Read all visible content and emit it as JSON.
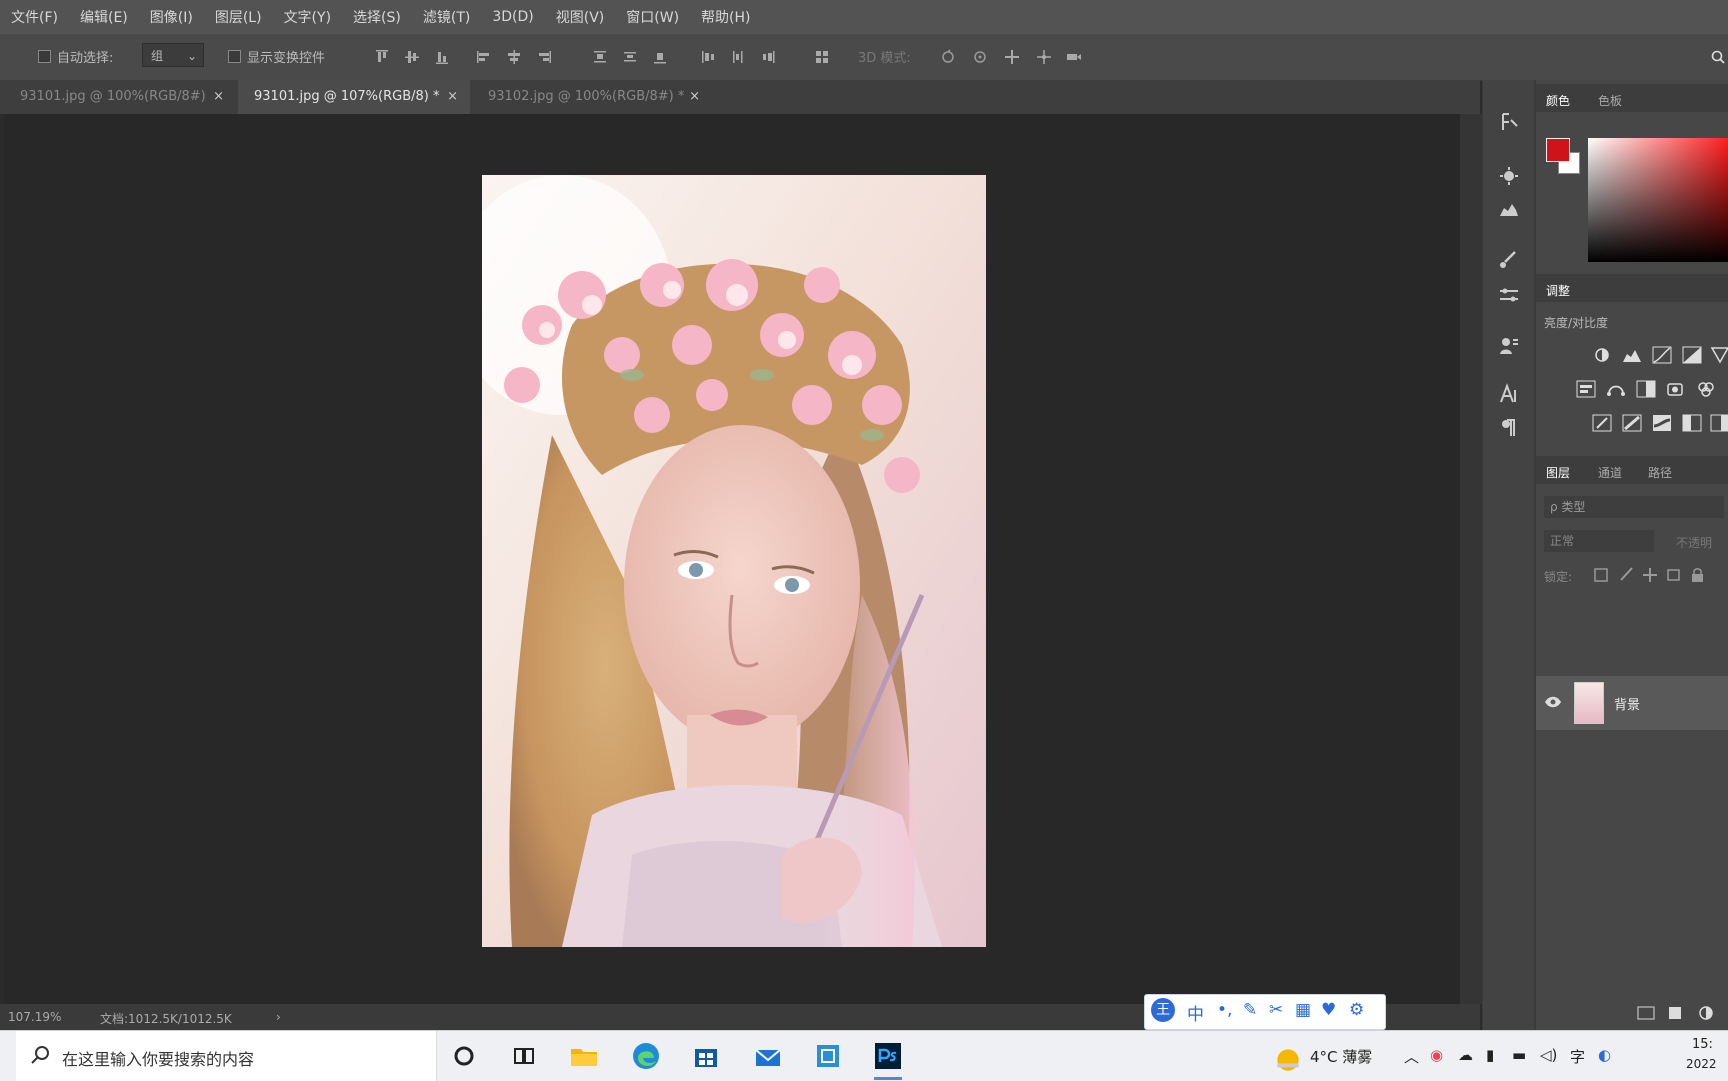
{
  "menu": [
    "文件(F)",
    "编辑(E)",
    "图像(I)",
    "图层(L)",
    "文字(Y)",
    "选择(S)",
    "滤镜(T)",
    "3D(D)",
    "视图(V)",
    "窗口(W)",
    "帮助(H)"
  ],
  "options": {
    "auto_select_label": "自动选择:",
    "auto_select_value": "组",
    "show_transform_label": "显示变换控件",
    "mode_3d_label": "3D 模式:"
  },
  "tabs": [
    {
      "label": "93101.jpg @ 100%(RGB/8#)",
      "close": "×"
    },
    {
      "label": "93101.jpg @ 107%(RGB/8) *",
      "close": "×"
    },
    {
      "label": "93102.jpg @ 100%(RGB/8#) *",
      "close": "×"
    }
  ],
  "status": {
    "zoom": "107.19%",
    "doc": "文档:1012.5K/1012.5K",
    "arrow": "›"
  },
  "panels": {
    "color_tab": "颜色",
    "swatches_tab": "色板",
    "adjust_tab": "调整",
    "adjust_label": "亮度/对比度",
    "layers_tab": "图层",
    "channels_tab": "通道",
    "paths_tab": "路径",
    "layer_filter": "ρ 类型",
    "blend_mode": "正常",
    "opacity_label": "不透明",
    "lock_label": "锁定:",
    "layer_name": "背景",
    "fg_color": "#d0121b",
    "bg_color": "#ffffff"
  },
  "taskbar": {
    "search_placeholder": "在这里输入你要搜索的内容",
    "weather": "4°C 薄雾",
    "time": "15:",
    "date": "2022"
  },
  "ime": {
    "logo": "王",
    "mode": "中"
  }
}
